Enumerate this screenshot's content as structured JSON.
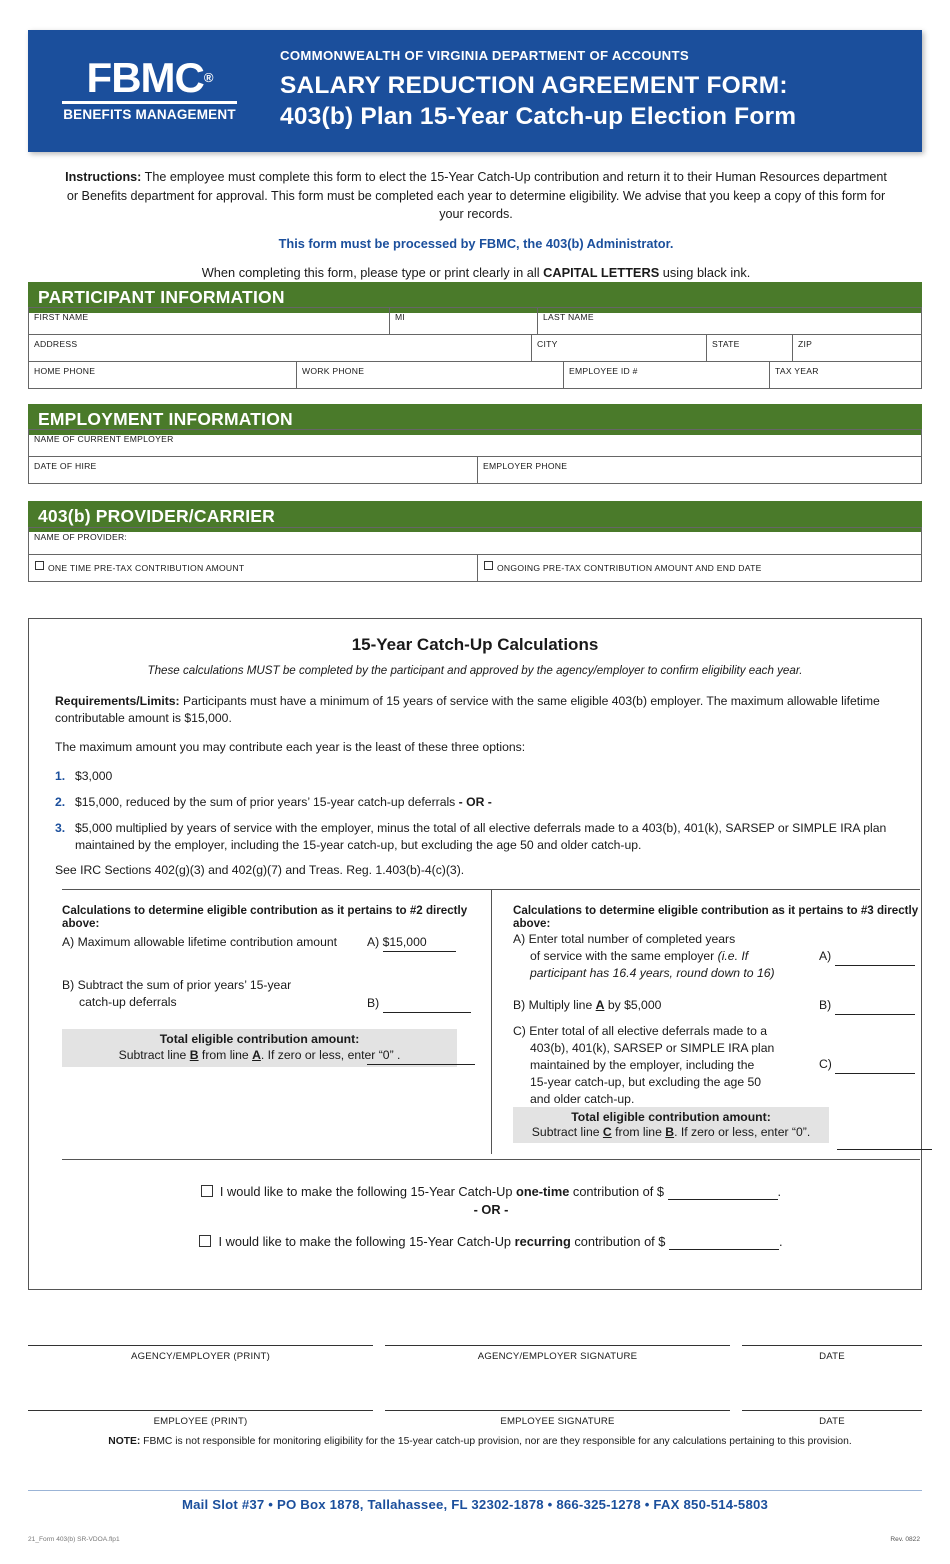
{
  "header": {
    "logo_main": "FBMC",
    "logo_reg": "®",
    "logo_sub": "BENEFITS MANAGEMENT",
    "eyebrow": "COMMONWEALTH OF VIRGINIA DEPARTMENT OF ACCOUNTS",
    "title_line1": "SALARY REDUCTION AGREEMENT FORM:",
    "title_line2": "403(b) Plan 15-Year Catch-up Election Form"
  },
  "instructions": {
    "label": "Instructions:",
    "body": " The employee must complete this form to elect the 15-Year Catch-Up contribution and return it to their Human Resources department or Benefits department for approval. This form must be completed each year to determine eligibility. We advise that you keep a copy of this form for your records.",
    "blue_line": "This form must be processed by FBMC, the 403(b) Administrator.",
    "last_line_a": "When completing this form, please type or print clearly in all ",
    "last_line_b": "CAPITAL LETTERS",
    "last_line_c": " using black ink."
  },
  "sections": {
    "participant": "PARTICIPANT INFORMATION",
    "employment": "EMPLOYMENT INFORMATION",
    "provider": "403(b) PROVIDER/CARRIER"
  },
  "participant_fields": {
    "first_name": "FIRST NAME",
    "mi": "MI",
    "last_name": "LAST NAME",
    "address": "ADDRESS",
    "city": "CITY",
    "state": "STATE",
    "zip": "ZIP",
    "home_phone": "HOME PHONE",
    "work_phone": "WORK PHONE",
    "employee_id": "EMPLOYEE ID #",
    "tax_year": "TAX YEAR"
  },
  "employment_fields": {
    "employer": "NAME OF CURRENT EMPLOYER",
    "date_of_hire": "DATE OF HIRE",
    "employer_phone": "EMPLOYER PHONE"
  },
  "provider_fields": {
    "name_of_provider": "NAME OF PROVIDER:",
    "one_time": "ONE TIME PRE-TAX CONTRIBUTION AMOUNT",
    "ongoing": "ONGOING PRE-TAX CONTRIBUTION AMOUNT AND END DATE"
  },
  "calc": {
    "title": "15-Year Catch-Up Calculations",
    "subtitle": "These calculations MUST be completed by the participant and approved by the agency/employer to confirm eligibility each year.",
    "req_label": "Requirements/Limits:",
    "req_body": " Participants must have a minimum of 15 years of service with the same eligible 403(b) employer. The maximum allowable lifetime contributable amount is $15,000.",
    "max_intro": "The maximum amount you may contribute each year is the least of these three options:",
    "options": [
      {
        "num": "1.",
        "text": "$3,000"
      },
      {
        "num": "2.",
        "text_a": "$15,000, reduced by the sum of prior years’ 15-year catch-up deferrals ",
        "text_b": "- OR -"
      },
      {
        "num": "3.",
        "text": "$5,000 multiplied by years of service with the employer, minus the total of all elective deferrals made to a 403(b), 401(k), SARSEP or SIMPLE IRA plan maintained by the employer, including the 15-year catch-up, but excluding the age 50 and older catch-up."
      }
    ],
    "irc_note": "See IRC Sections 402(g)(3) and 402(g)(7) and Treas. Reg. 1.403(b)-4(c)(3).",
    "left": {
      "heading": "Calculations to determine eligible contribution as it pertains to #2 directly above:",
      "line_a": "A) Maximum allowable lifetime contribution amount",
      "line_a_val_label": "A)",
      "line_a_val": "$15,000",
      "line_b_1": "B) Subtract the sum of prior years’ 15-year",
      "line_b_2": "catch-up deferrals",
      "line_b_val_label": "B)",
      "total_label": "Total eligible contribution amount:",
      "total_sub_a": "Subtract line ",
      "total_sub_b": "B",
      "total_sub_c": " from line ",
      "total_sub_d": "A",
      "total_sub_e": ". If zero or less, enter “0” ."
    },
    "right": {
      "heading": "Calculations to determine eligible contribution as it pertains to #3 directly above:",
      "a_1": "A) Enter total number of completed years",
      "a_2": "of service with the same employer ",
      "a_2_ital": "(i.e. If",
      "a_3_ital": "participant has 16.4 years, round down to 16)",
      "a_label": "A)",
      "b_text_1": "B) Multiply line ",
      "b_text_bold": "A",
      "b_text_2": " by $5,000",
      "b_label": "B)",
      "c_1": "C) Enter total of all elective deferrals made to a",
      "c_2": "403(b), 401(k), SARSEP or SIMPLE IRA plan",
      "c_3": "maintained by the employer, including the",
      "c_4": "15-year catch-up, but excluding the age 50",
      "c_5": "and older catch-up.",
      "c_label": "C)",
      "total_label": "Total eligible contribution amount:",
      "total_sub_a": "Subtract line ",
      "total_sub_b": "C",
      "total_sub_c": " from line ",
      "total_sub_d": "B",
      "total_sub_e": ". If zero or less, enter “0”."
    }
  },
  "election": {
    "opt1_a": "I would like to make the following 15-Year Catch-Up ",
    "opt1_bold": "one-time",
    "opt1_b": " contribution of $ ",
    "opt1_end": ".",
    "or": "- OR -",
    "opt2_a": "I would like to make the following 15-Year Catch-Up ",
    "opt2_bold": "recurring",
    "opt2_b": " contribution of $ ",
    "opt2_end": "."
  },
  "signatures": {
    "row1": [
      "AGENCY/EMPLOYER (PRINT)",
      "AGENCY/EMPLOYER SIGNATURE",
      "DATE"
    ],
    "row2": [
      "EMPLOYEE (PRINT)",
      "EMPLOYEE SIGNATURE",
      "DATE"
    ]
  },
  "note": {
    "label": "NOTE:",
    "body": " FBMC is not responsible for monitoring eligibility for the 15-year catch-up provision, nor are they responsible for any calculations pertaining to this provision."
  },
  "footer": {
    "text": "Mail Slot #37  •  PO Box 1878, Tallahassee, FL  32302-1878  •  866-325-1278  •  FAX 850-514-5803",
    "form_id": "21_Form 403(b) SR-VDOA.flp1",
    "rev": "Rev. 0822"
  },
  "colors": {
    "brand_blue": "#1b4f9c",
    "section_green": "#4a7a2a"
  }
}
